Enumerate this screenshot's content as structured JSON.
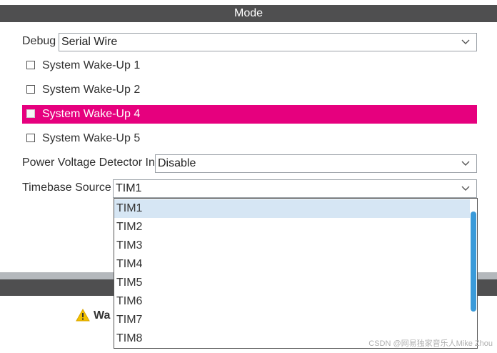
{
  "header": {
    "title": "Mode"
  },
  "debug": {
    "label": "Debug",
    "value": "Serial Wire"
  },
  "wakeups": [
    {
      "label": "System Wake-Up 1",
      "selected": false
    },
    {
      "label": "System Wake-Up 2",
      "selected": false
    },
    {
      "label": "System Wake-Up 4",
      "selected": true
    },
    {
      "label": "System Wake-Up 5",
      "selected": false
    }
  ],
  "pvd": {
    "label": "Power Voltage Detector In",
    "value": "Disable"
  },
  "timebase": {
    "label": "Timebase Source",
    "value": "TIM1",
    "options": [
      "TIM1",
      "TIM2",
      "TIM3",
      "TIM4",
      "TIM5",
      "TIM6",
      "TIM7",
      "TIM8"
    ],
    "highlighted": "TIM1"
  },
  "warning": {
    "text": "Wa"
  },
  "watermark": "CSDN @网易独家音乐人Mike Zhou",
  "colors": {
    "header_bg": "#4f4f50",
    "selected_row": "#e6007e",
    "highlight_option": "#d6e6f4",
    "scrollbar": "#3a9ad9"
  }
}
